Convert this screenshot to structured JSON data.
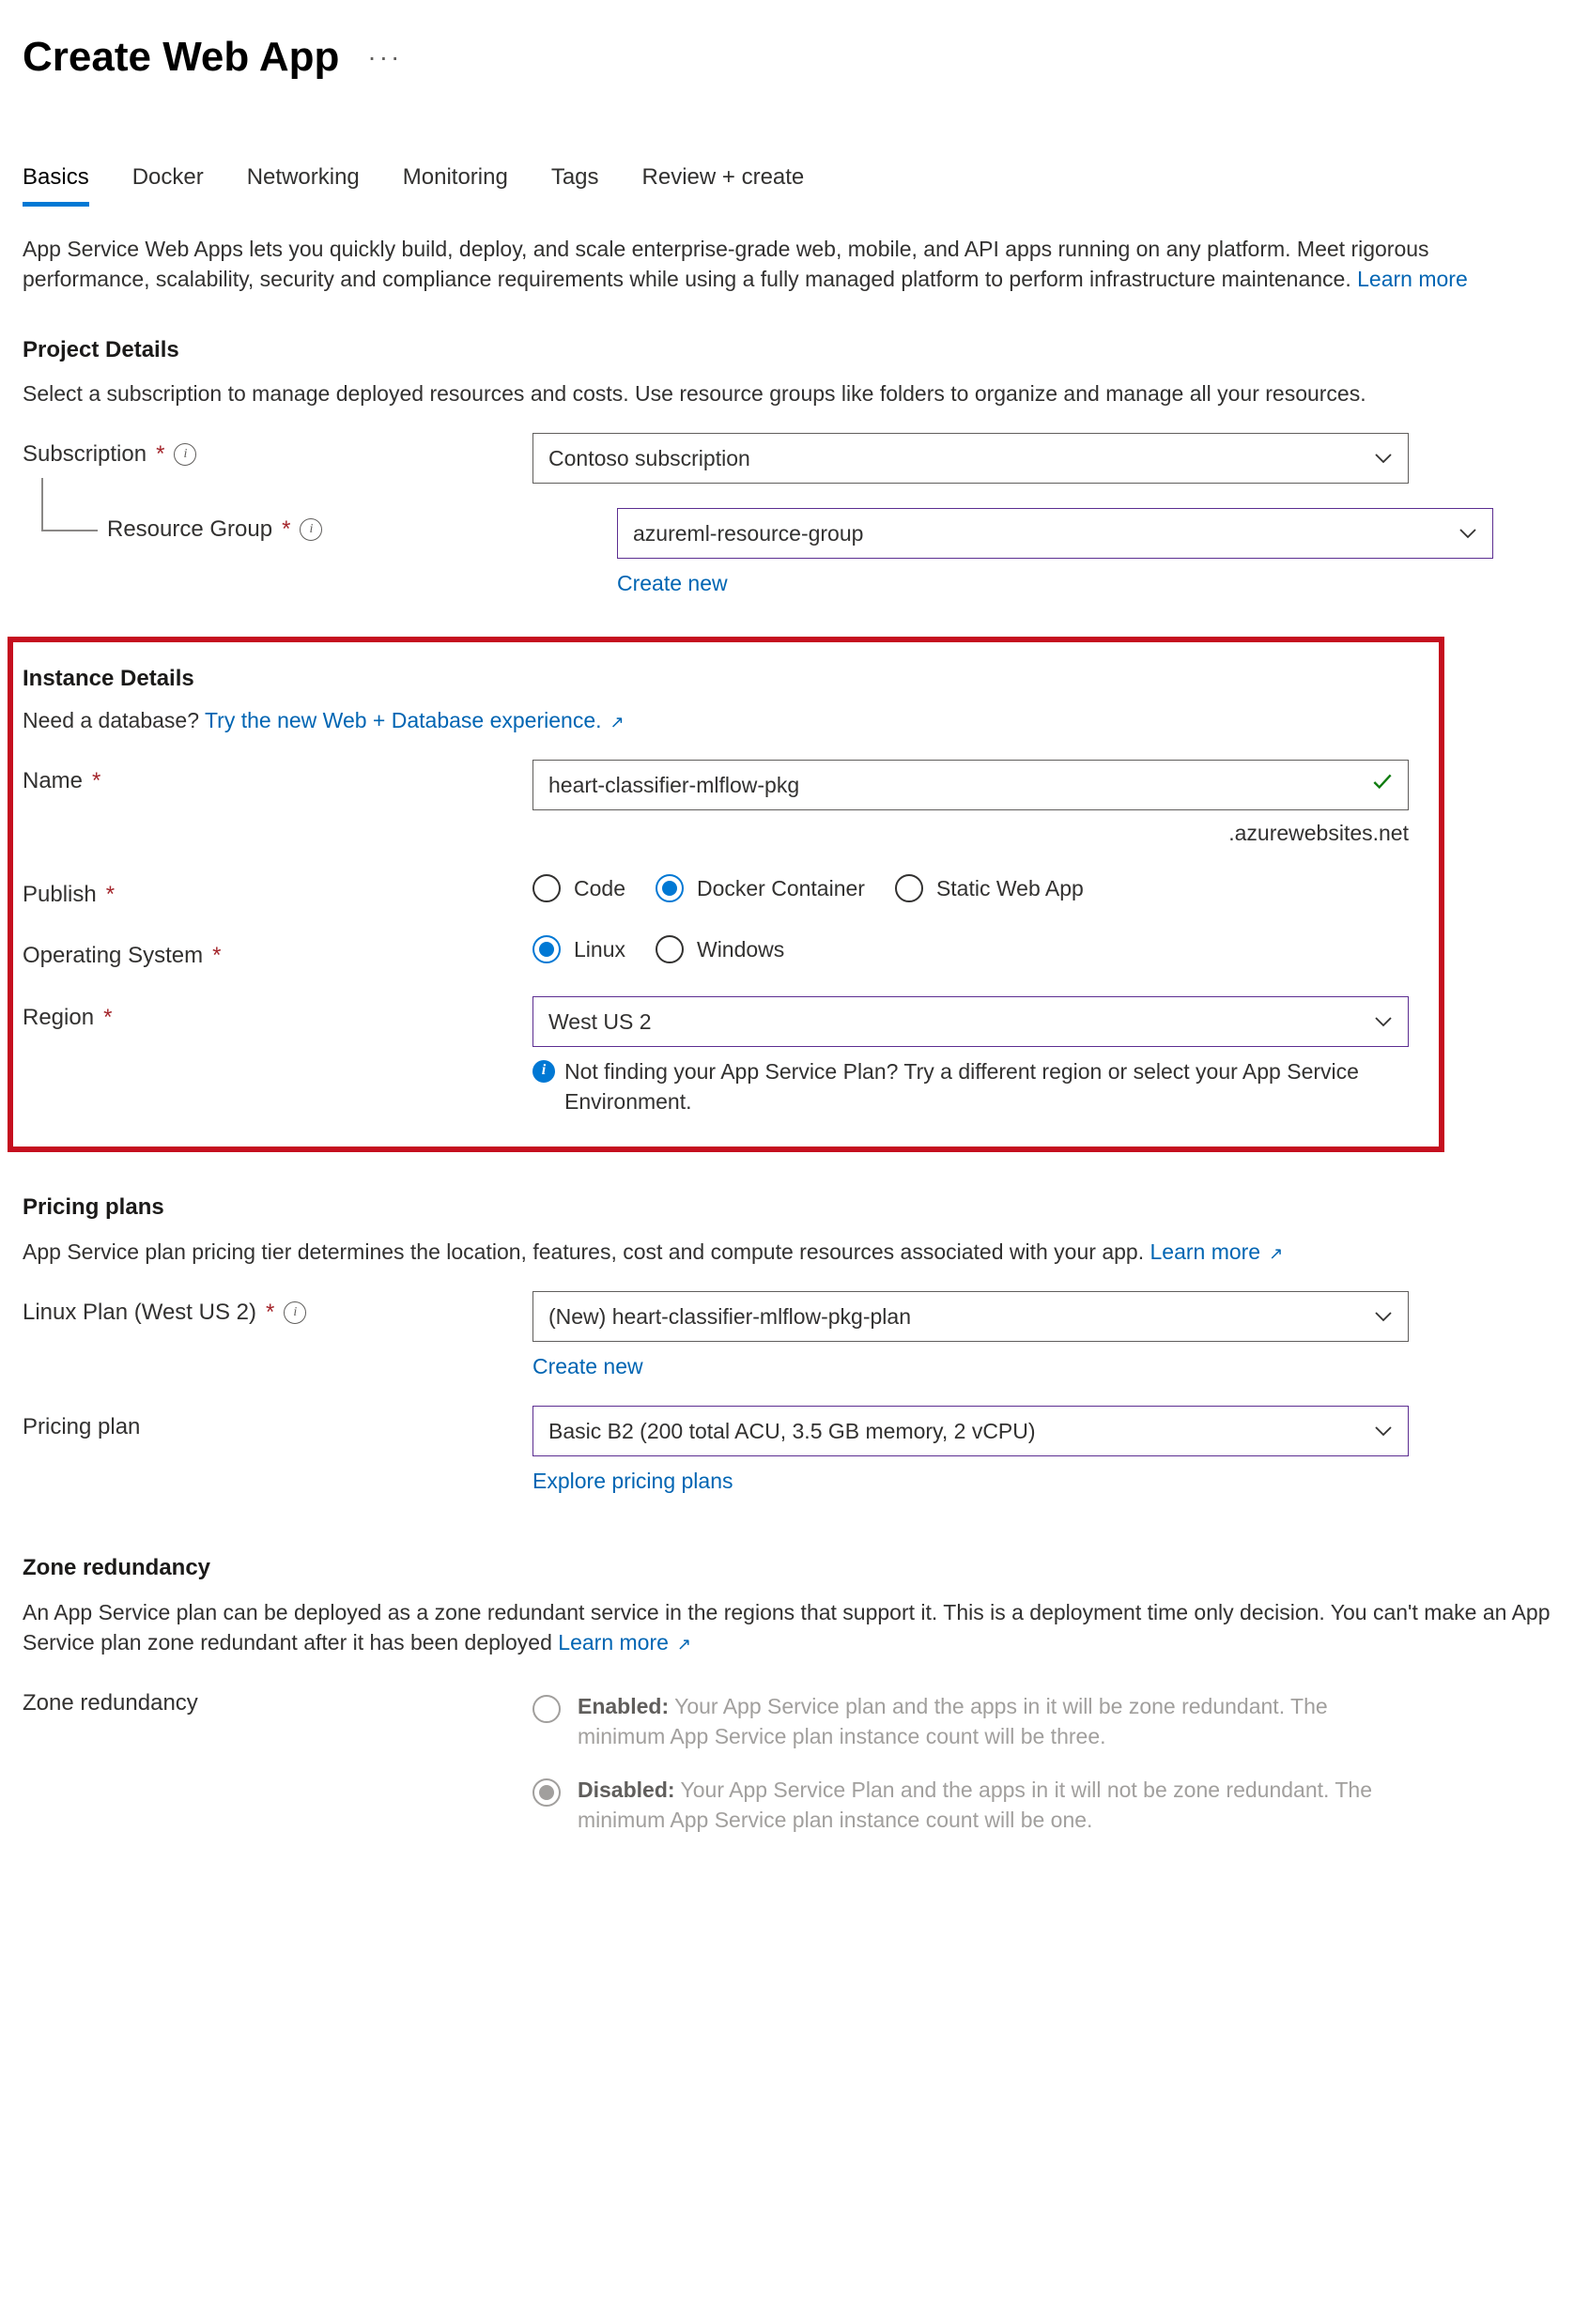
{
  "header": {
    "title": "Create Web App"
  },
  "tabs": [
    {
      "id": "basics",
      "label": "Basics",
      "active": true
    },
    {
      "id": "docker",
      "label": "Docker"
    },
    {
      "id": "networking",
      "label": "Networking"
    },
    {
      "id": "monitoring",
      "label": "Monitoring"
    },
    {
      "id": "tags",
      "label": "Tags"
    },
    {
      "id": "review",
      "label": "Review + create"
    }
  ],
  "intro": {
    "text": "App Service Web Apps lets you quickly build, deploy, and scale enterprise-grade web, mobile, and API apps running on any platform. Meet rigorous performance, scalability, security and compliance requirements while using a fully managed platform to perform infrastructure maintenance.  ",
    "learn_more": "Learn more"
  },
  "project": {
    "title": "Project Details",
    "desc": "Select a subscription to manage deployed resources and costs. Use resource groups like folders to organize and manage all your resources.",
    "subscription_label": "Subscription",
    "subscription_value": "Contoso subscription",
    "rg_label": "Resource Group",
    "rg_value": "azureml-resource-group",
    "create_new": "Create new"
  },
  "instance": {
    "title": "Instance Details",
    "db_prompt": "Need a database? ",
    "db_link": "Try the new Web + Database experience.",
    "name_label": "Name",
    "name_value": "heart-classifier-mlflow-pkg",
    "name_suffix": ".azurewebsites.net",
    "publish_label": "Publish",
    "publish_options": [
      {
        "id": "code",
        "label": "Code",
        "selected": false
      },
      {
        "id": "docker",
        "label": "Docker Container",
        "selected": true
      },
      {
        "id": "static",
        "label": "Static Web App",
        "selected": false
      }
    ],
    "os_label": "Operating System",
    "os_options": [
      {
        "id": "linux",
        "label": "Linux",
        "selected": true
      },
      {
        "id": "windows",
        "label": "Windows",
        "selected": false
      }
    ],
    "region_label": "Region",
    "region_value": "West US 2",
    "region_hint": "Not finding your App Service Plan? Try a different region or select your App Service Environment."
  },
  "pricing": {
    "title": "Pricing plans",
    "desc": "App Service plan pricing tier determines the location, features, cost and compute resources associated with your app. ",
    "learn_more": "Learn more",
    "linux_plan_label": "Linux Plan (West US 2)",
    "linux_plan_value": "(New) heart-classifier-mlflow-pkg-plan",
    "create_new": "Create new",
    "plan_label": "Pricing plan",
    "plan_value": "Basic B2 (200 total ACU, 3.5 GB memory, 2 vCPU)",
    "explore": "Explore pricing plans"
  },
  "zone": {
    "title": "Zone redundancy",
    "desc": "An App Service plan can be deployed as a zone redundant service in the regions that support it. This is a deployment time only decision. You can't make an App Service plan zone redundant after it has been deployed ",
    "learn_more": "Learn more",
    "label": "Zone redundancy",
    "enabled_title": "Enabled:",
    "enabled_desc": " Your App Service plan and the apps in it will be zone redundant. The minimum App Service plan instance count will be three.",
    "disabled_title": "Disabled:",
    "disabled_desc": " Your App Service Plan and the apps in it will not be zone redundant. The minimum App Service plan instance count will be one."
  }
}
